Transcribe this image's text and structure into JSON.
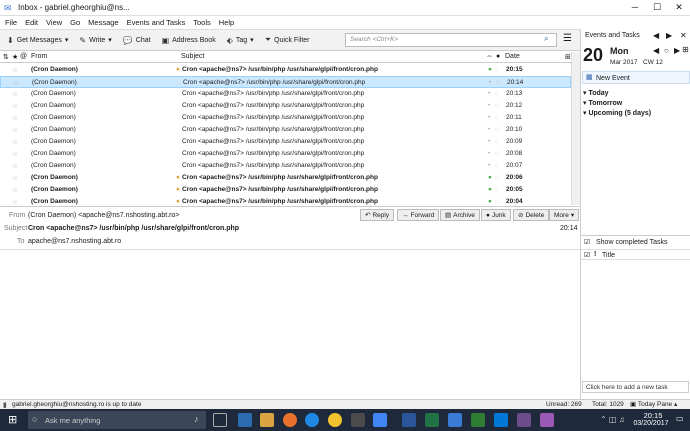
{
  "window": {
    "title": "Inbox - gabriel.gheorghiu@ns..."
  },
  "menu": [
    "File",
    "Edit",
    "View",
    "Go",
    "Message",
    "Events and Tasks",
    "Tools",
    "Help"
  ],
  "toolbar": {
    "get_messages": "Get Messages",
    "write": "Write",
    "chat": "Chat",
    "address_book": "Address Book",
    "tag": "Tag",
    "quick_filter": "Quick Filter",
    "search_placeholder": "Search <Ctrl+K>"
  },
  "columns": {
    "from": "From",
    "subject": "Subject",
    "date": "Date"
  },
  "messages": [
    {
      "from": "(Cron Daemon)",
      "subject": "Cron <apache@ns7> /usr/bin/php /usr/share/glpi/front/cron.php",
      "date": "20:15",
      "bold": true,
      "selected": false,
      "unread_dot": true
    },
    {
      "from": "(Cron Daemon)",
      "subject": "Cron <apache@ns7> /usr/bin/php /usr/share/glpi/front/cron.php",
      "date": "20:14",
      "bold": false,
      "selected": true,
      "unread_dot": false
    },
    {
      "from": "(Cron Daemon)",
      "subject": "Cron <apache@ns7> /usr/bin/php /usr/share/glpi/front/cron.php",
      "date": "20:13",
      "bold": false,
      "selected": false,
      "unread_dot": false
    },
    {
      "from": "(Cron Daemon)",
      "subject": "Cron <apache@ns7> /usr/bin/php /usr/share/glpi/front/cron.php",
      "date": "20:12",
      "bold": false,
      "selected": false,
      "unread_dot": false
    },
    {
      "from": "(Cron Daemon)",
      "subject": "Cron <apache@ns7> /usr/bin/php /usr/share/glpi/front/cron.php",
      "date": "20:11",
      "bold": false,
      "selected": false,
      "unread_dot": false
    },
    {
      "from": "(Cron Daemon)",
      "subject": "Cron <apache@ns7> /usr/bin/php /usr/share/glpi/front/cron.php",
      "date": "20:10",
      "bold": false,
      "selected": false,
      "unread_dot": false
    },
    {
      "from": "(Cron Daemon)",
      "subject": "Cron <apache@ns7> /usr/bin/php /usr/share/glpi/front/cron.php",
      "date": "20:09",
      "bold": false,
      "selected": false,
      "unread_dot": false
    },
    {
      "from": "(Cron Daemon)",
      "subject": "Cron <apache@ns7> /usr/bin/php /usr/share/glpi/front/cron.php",
      "date": "20:08",
      "bold": false,
      "selected": false,
      "unread_dot": false
    },
    {
      "from": "(Cron Daemon)",
      "subject": "Cron <apache@ns7> /usr/bin/php /usr/share/glpi/front/cron.php",
      "date": "20:07",
      "bold": false,
      "selected": false,
      "unread_dot": false
    },
    {
      "from": "(Cron Daemon)",
      "subject": "Cron <apache@ns7> /usr/bin/php /usr/share/glpi/front/cron.php",
      "date": "20:06",
      "bold": true,
      "selected": false,
      "unread_dot": true
    },
    {
      "from": "(Cron Daemon)",
      "subject": "Cron <apache@ns7> /usr/bin/php /usr/share/glpi/front/cron.php",
      "date": "20:05",
      "bold": true,
      "selected": false,
      "unread_dot": true
    },
    {
      "from": "(Cron Daemon)",
      "subject": "Cron <apache@ns7> /usr/bin/php /usr/share/glpi/front/cron.php",
      "date": "20:04",
      "bold": true,
      "selected": false,
      "unread_dot": true
    }
  ],
  "header": {
    "from_label": "From",
    "from_value": "(Cron Daemon) <apache@ns7.nshosting.abt.ro>",
    "subject_label": "Subject",
    "subject_value": "Cron <apache@ns7> /usr/bin/php /usr/share/glpi/front/cron.php",
    "to_label": "To",
    "to_value": "apache@ns7.nshosting.abt.ro",
    "time": "20:14",
    "buttons": [
      "Reply",
      "Forward",
      "Archive",
      "Junk",
      "Delete",
      "More"
    ]
  },
  "events": {
    "title": "Events and Tasks",
    "day": "20",
    "weekday": "Mon",
    "month_year": "Mar 2017",
    "cw": "CW 12",
    "new_event": "New Event",
    "sections": [
      "Today",
      "Tomorrow",
      "Upcoming (5 days)"
    ],
    "show_completed": "Show completed Tasks",
    "title_col": "Title",
    "add_task_placeholder": "Click here to add a new task"
  },
  "status": {
    "message": "gabriel.gheorghiu@nshosting.ro is up to date",
    "unread": "Unread: 269",
    "total": "Total: 1029",
    "today_pane": "Today Pane"
  },
  "taskbar": {
    "search": "Ask me anything",
    "time": "20:15",
    "date": "03/20/2017"
  }
}
